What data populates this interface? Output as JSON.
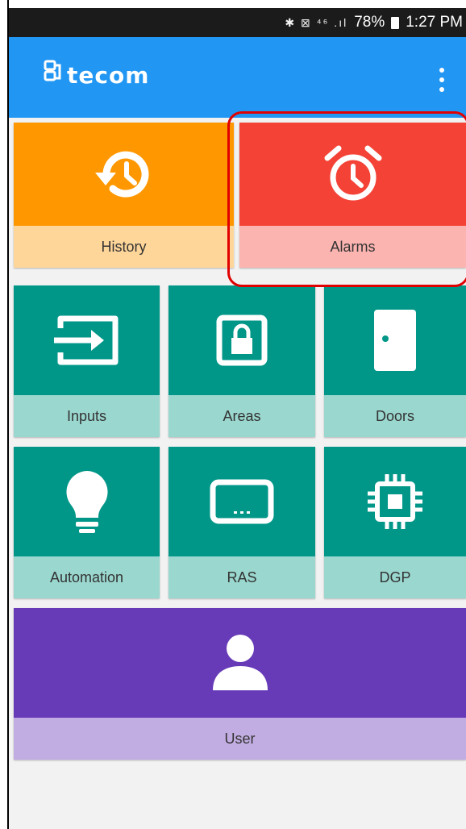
{
  "status_bar": {
    "signal_icons": "✱ ⊠ ⁴⁶ .ıl",
    "battery": "78%",
    "time": "1:27 PM"
  },
  "app_bar": {
    "logo_text": "tecom",
    "menu_icon": "more-vert-icon",
    "color": "#2196f3"
  },
  "tiles": [
    {
      "label": "History",
      "icon": "history-icon",
      "color": "#ff9800"
    },
    {
      "label": "Alarms",
      "icon": "alarm-clock-icon",
      "color": "#f44336",
      "highlighted": true
    },
    {
      "label": "Inputs",
      "icon": "input-icon",
      "color": "#009688"
    },
    {
      "label": "Areas",
      "icon": "lock-area-icon",
      "color": "#009688"
    },
    {
      "label": "Doors",
      "icon": "door-icon",
      "color": "#009688"
    },
    {
      "label": "Automation",
      "icon": "lightbulb-icon",
      "color": "#009688"
    },
    {
      "label": "RAS",
      "icon": "keypad-icon",
      "color": "#009688"
    },
    {
      "label": "DGP",
      "icon": "chip-icon",
      "color": "#009688"
    },
    {
      "label": "User",
      "icon": "user-icon",
      "color": "#673ab7"
    }
  ]
}
